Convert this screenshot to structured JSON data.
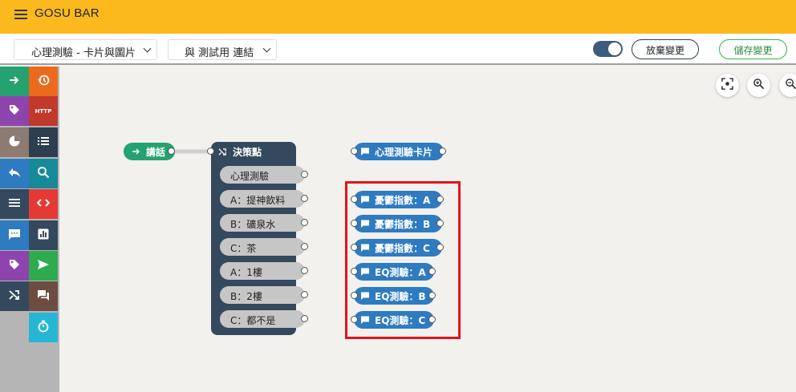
{
  "app": {
    "title": "GOSU BAR"
  },
  "toolbar": {
    "flow_select": "心理測驗 - 卡片與圖片",
    "link_select": "與 測試用 連結",
    "discard_label": "放棄變更",
    "save_label": "儲存變更",
    "toggle_on": true
  },
  "palette": [
    {
      "name": "arrow-right-icon",
      "color": "#25a26f"
    },
    {
      "name": "history-icon",
      "color": "#ec6a1c"
    },
    {
      "name": "tag-icon",
      "color": "#8e44ad"
    },
    {
      "name": "http-icon",
      "color": "#c0392b",
      "label": "HTTP"
    },
    {
      "name": "pie-chart-icon",
      "color": "#8d7b71"
    },
    {
      "name": "list-icon",
      "color": "#2c3e50"
    },
    {
      "name": "reply-icon",
      "color": "#2e7bc1"
    },
    {
      "name": "search-icon",
      "color": "#16899b"
    },
    {
      "name": "menu-icon",
      "color": "#34495e"
    },
    {
      "name": "code-icon",
      "color": "#e53935"
    },
    {
      "name": "chat-icon",
      "color": "#2e7bc1"
    },
    {
      "name": "bar-chart-icon",
      "color": "#34495e"
    },
    {
      "name": "tag-icon",
      "color": "#8e44ad"
    },
    {
      "name": "send-icon",
      "color": "#2eaa4f"
    },
    {
      "name": "shuffle-icon",
      "color": "#34495e"
    },
    {
      "name": "forum-icon",
      "color": "#6d4c41"
    },
    {
      "name": "timer-icon",
      "color": "#26b6d3"
    }
  ],
  "flow": {
    "start_node": "講話",
    "decision_title": "決策點",
    "decision_options": [
      "心理測驗",
      "A：提神飲料",
      "B：礦泉水",
      "C：茶",
      "A：1樓",
      "B：2樓",
      "C：都不是"
    ],
    "card_node": "心理測驗卡片",
    "message_nodes": [
      "憂鬱指數：A",
      "憂鬱指數：B",
      "憂鬱指數：C",
      "EQ測驗：A",
      "EQ測驗：B",
      "EQ測驗：C"
    ]
  }
}
